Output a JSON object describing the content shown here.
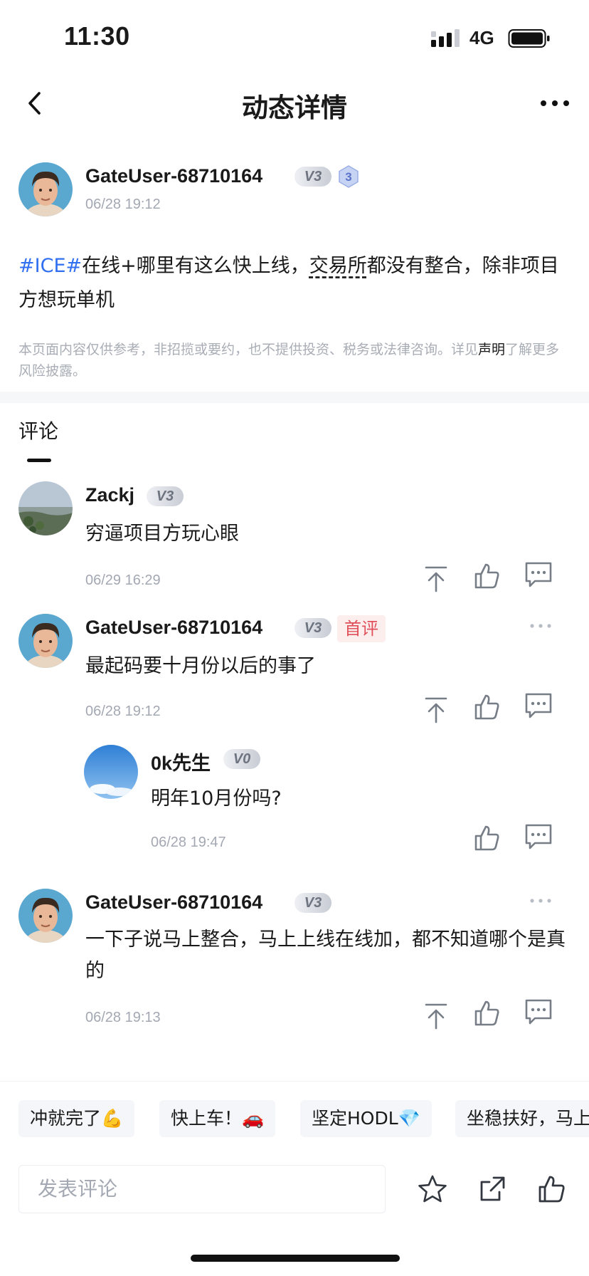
{
  "status_bar": {
    "time": "11:30",
    "network": "4G"
  },
  "nav": {
    "title": "动态详情"
  },
  "post": {
    "author_name": "GateUser-68710164",
    "author_vip": "V3",
    "author_level": "3",
    "timestamp": "06/28 19:12",
    "tag": "#ICE#",
    "text_part1": "在线+哪里有这么快上线，",
    "text_underlined": "交易所",
    "text_part2": "都没有整合，除非项目方想玩单机",
    "disclaimer_text": "本页面内容仅供参考，非招揽或要约，也不提供投资、税务或法律咨询。详见",
    "disclaimer_link": "声明",
    "disclaimer_tail": "了解更多风险披露。"
  },
  "comments_tab": {
    "label": "评论"
  },
  "comments": [
    {
      "user": "Zackj",
      "vip": "V3",
      "text": "穷逼项目方玩心眼",
      "time": "06/29 16:29"
    },
    {
      "user": "GateUser-68710164",
      "vip": "V3",
      "badge": "首评",
      "text": "最起码要十月份以后的事了",
      "time": "06/28 19:12"
    },
    {
      "user": "0k先生",
      "vip": "V0",
      "text": "明年10月份吗?",
      "time": "06/28 19:47"
    },
    {
      "user": "GateUser-68710164",
      "vip": "V3",
      "text": "一下子说马上整合，马上上线在线加，都不知道哪个是真的",
      "time": "06/28 19:13"
    }
  ],
  "quick_replies": [
    "冲就完了💪",
    "快上车！🚗",
    "坚定HODL💎",
    "坐稳扶好，马上"
  ],
  "input": {
    "placeholder": "发表评论"
  },
  "colors": {
    "tag_blue": "#2f6ff0",
    "first_badge_red": "#e0505a",
    "muted_gray": "#a3a8b2"
  }
}
